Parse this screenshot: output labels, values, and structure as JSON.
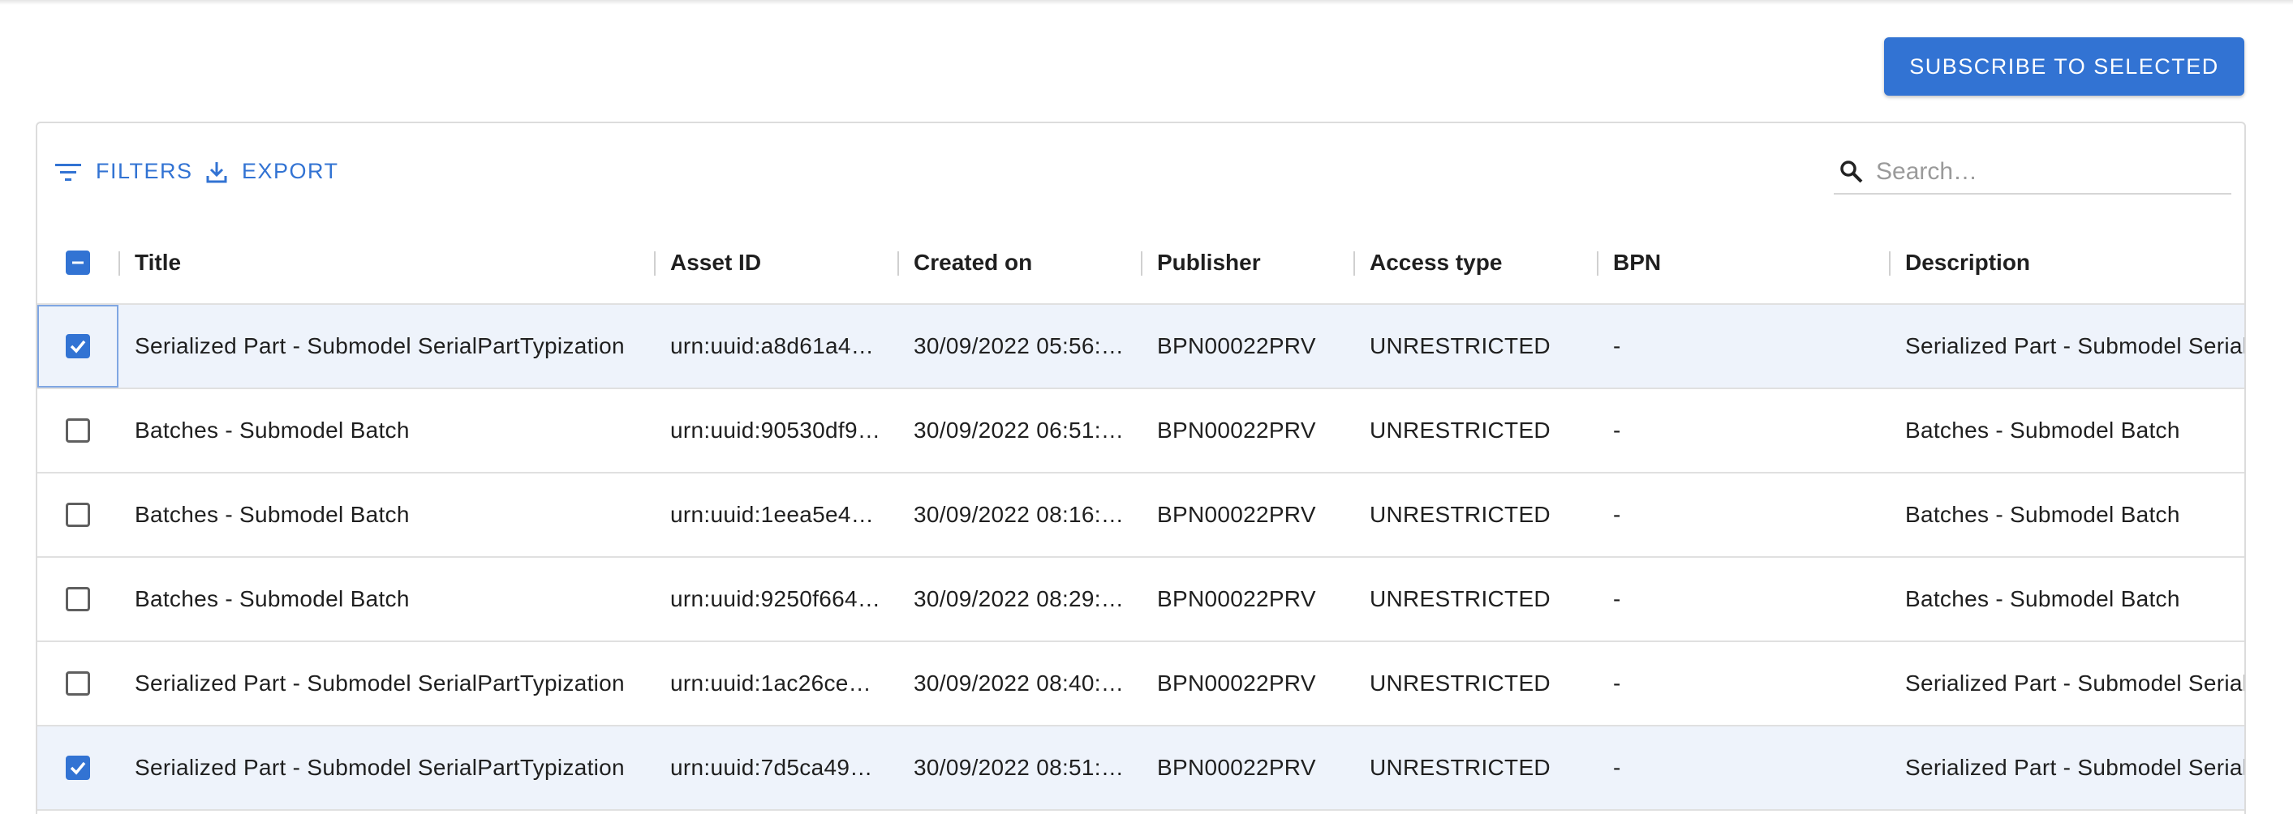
{
  "actions": {
    "subscribe_label": "SUBSCRIBE TO SELECTED"
  },
  "toolbar": {
    "filters_label": "FILTERS",
    "export_label": "EXPORT",
    "search_placeholder": "Search…",
    "search_value": ""
  },
  "columns": {
    "title": "Title",
    "asset_id": "Asset ID",
    "created_on": "Created on",
    "publisher": "Publisher",
    "access_type": "Access type",
    "bpn": "BPN",
    "description": "Description"
  },
  "header_checkbox_state": "indeterminate",
  "rows": [
    {
      "checked": true,
      "title": "Serialized Part - Submodel SerialPartTypization",
      "asset_id": "urn:uuid:a8d61a4…",
      "created_on": "30/09/2022 05:56:…",
      "publisher": "BPN00022PRV",
      "access_type": "UNRESTRICTED",
      "bpn": "-",
      "description": "Serialized Part - Submodel Serial"
    },
    {
      "checked": false,
      "title": "Batches - Submodel Batch",
      "asset_id": "urn:uuid:90530df9…",
      "created_on": "30/09/2022 06:51:…",
      "publisher": "BPN00022PRV",
      "access_type": "UNRESTRICTED",
      "bpn": "-",
      "description": "Batches - Submodel Batch"
    },
    {
      "checked": false,
      "title": "Batches - Submodel Batch",
      "asset_id": "urn:uuid:1eea5e4…",
      "created_on": "30/09/2022 08:16:…",
      "publisher": "BPN00022PRV",
      "access_type": "UNRESTRICTED",
      "bpn": "-",
      "description": "Batches - Submodel Batch"
    },
    {
      "checked": false,
      "title": "Batches - Submodel Batch",
      "asset_id": "urn:uuid:9250f664…",
      "created_on": "30/09/2022 08:29:…",
      "publisher": "BPN00022PRV",
      "access_type": "UNRESTRICTED",
      "bpn": "-",
      "description": "Batches - Submodel Batch"
    },
    {
      "checked": false,
      "title": "Serialized Part - Submodel SerialPartTypization",
      "asset_id": "urn:uuid:1ac26ce…",
      "created_on": "30/09/2022 08:40:…",
      "publisher": "BPN00022PRV",
      "access_type": "UNRESTRICTED",
      "bpn": "-",
      "description": "Serialized Part - Submodel Serial"
    },
    {
      "checked": true,
      "title": "Serialized Part - Submodel SerialPartTypization",
      "asset_id": "urn:uuid:7d5ca49…",
      "created_on": "30/09/2022 08:51:…",
      "publisher": "BPN00022PRV",
      "access_type": "UNRESTRICTED",
      "bpn": "-",
      "description": "Serialized Part - Submodel Serial"
    }
  ],
  "colors": {
    "accent": "#3273d3",
    "selected_row": "#eef3fb",
    "border": "#e0e0e0"
  }
}
